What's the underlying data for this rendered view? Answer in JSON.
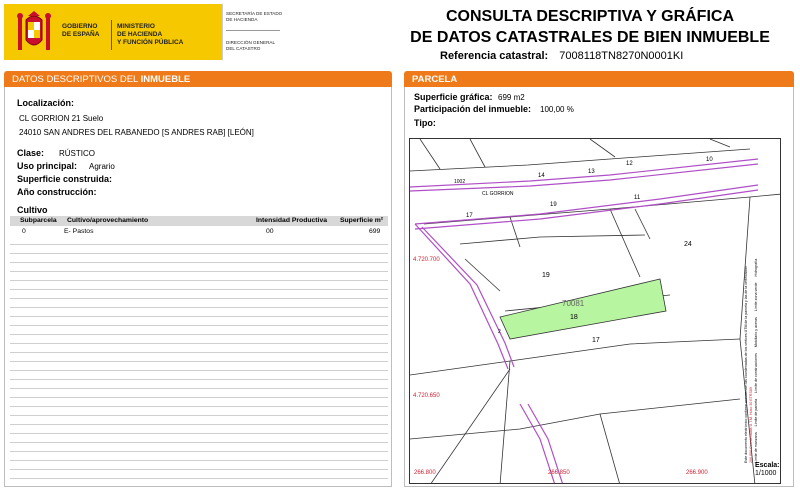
{
  "header": {
    "gov_line1": "GOBIERNO",
    "gov_line2": "DE ESPAÑA",
    "ministry_line1": "MINISTERIO",
    "ministry_line2": "DE HACIENDA",
    "ministry_line3": "Y FUNCIÓN PÚBLICA",
    "secretaria_line1": "SECRETARÍA DE ESTADO",
    "secretaria_line2": "DE HACIENDA",
    "direccion_line1": "DIRECCIÓN GENERAL",
    "direccion_line2": "DEL CATASTRO",
    "title_line1": "CONSULTA DESCRIPTIVA Y GRÁFICA",
    "title_line2": "DE DATOS CATASTRALES DE BIEN INMUEBLE",
    "ref_label": "Referencia catastral:",
    "ref_value": "7008118TN8270N0001KI"
  },
  "left_panel": {
    "head_prefix": "DATOS DESCRIPTIVOS DEL ",
    "head_strong": "INMUEBLE",
    "localizacion_label": "Localización:",
    "address_line1": "CL GORRION 21 Suelo",
    "address_line2": "24010 SAN ANDRES DEL RABANEDO [S ANDRES RAB] [LEÓN]",
    "clase_label": "Clase:",
    "clase_value": "RÚSTICO",
    "uso_label": "Uso principal:",
    "uso_value": "Agrario",
    "superficie_label": "Superficie construida:",
    "anio_label": "Año construcción:",
    "cultivo_label": "Cultivo",
    "table": {
      "headers": [
        "Subparcela",
        "Cultivo/aprovechamiento",
        "Intensidad Productiva",
        "Superficie m²"
      ],
      "rows": [
        [
          "0",
          "E- Pastos",
          "00",
          "699"
        ]
      ]
    }
  },
  "right_panel": {
    "head": "PARCELA",
    "sup_grafica_label": "Superficie gráfica:",
    "sup_grafica_value": "699 m2",
    "participacion_label": "Participación del inmueble:",
    "participacion_value": "100,00 %",
    "tipo_label": "Tipo:",
    "map": {
      "street_label": "CL GORRION",
      "parcel_number": "70081",
      "labels": [
        "24",
        "19",
        "18",
        "17",
        "14",
        "13",
        "12",
        "10",
        "11",
        "17",
        "1002",
        "2",
        "19"
      ],
      "coord_y1": "4.720.700",
      "coord_y2": "4.720.650",
      "coord_x1": "266.800",
      "coord_x2": "266.850",
      "coord_x3": "266.900",
      "legend_note1": "Este documento electrónico contiene anexas con las coordenadas de los vértices UTM de la parcela y las de la certificación",
      "legend_note2": "266.800 Coordenadas U.T.M. Huso 30 ETRS89",
      "legend_items": [
        "Límite de manzana",
        "Límite de parcela",
        "Límite de construcciones",
        "Mobiliario y aceras",
        "Límite zona verde",
        "Hidrografía"
      ],
      "scale_label": "Escala:",
      "scale_value": "1/1000"
    },
    "colors": {
      "parcel_fill": "#b7f5a0",
      "street_lines": "#b04fc7",
      "header_orange": "#ef7a1a"
    }
  }
}
